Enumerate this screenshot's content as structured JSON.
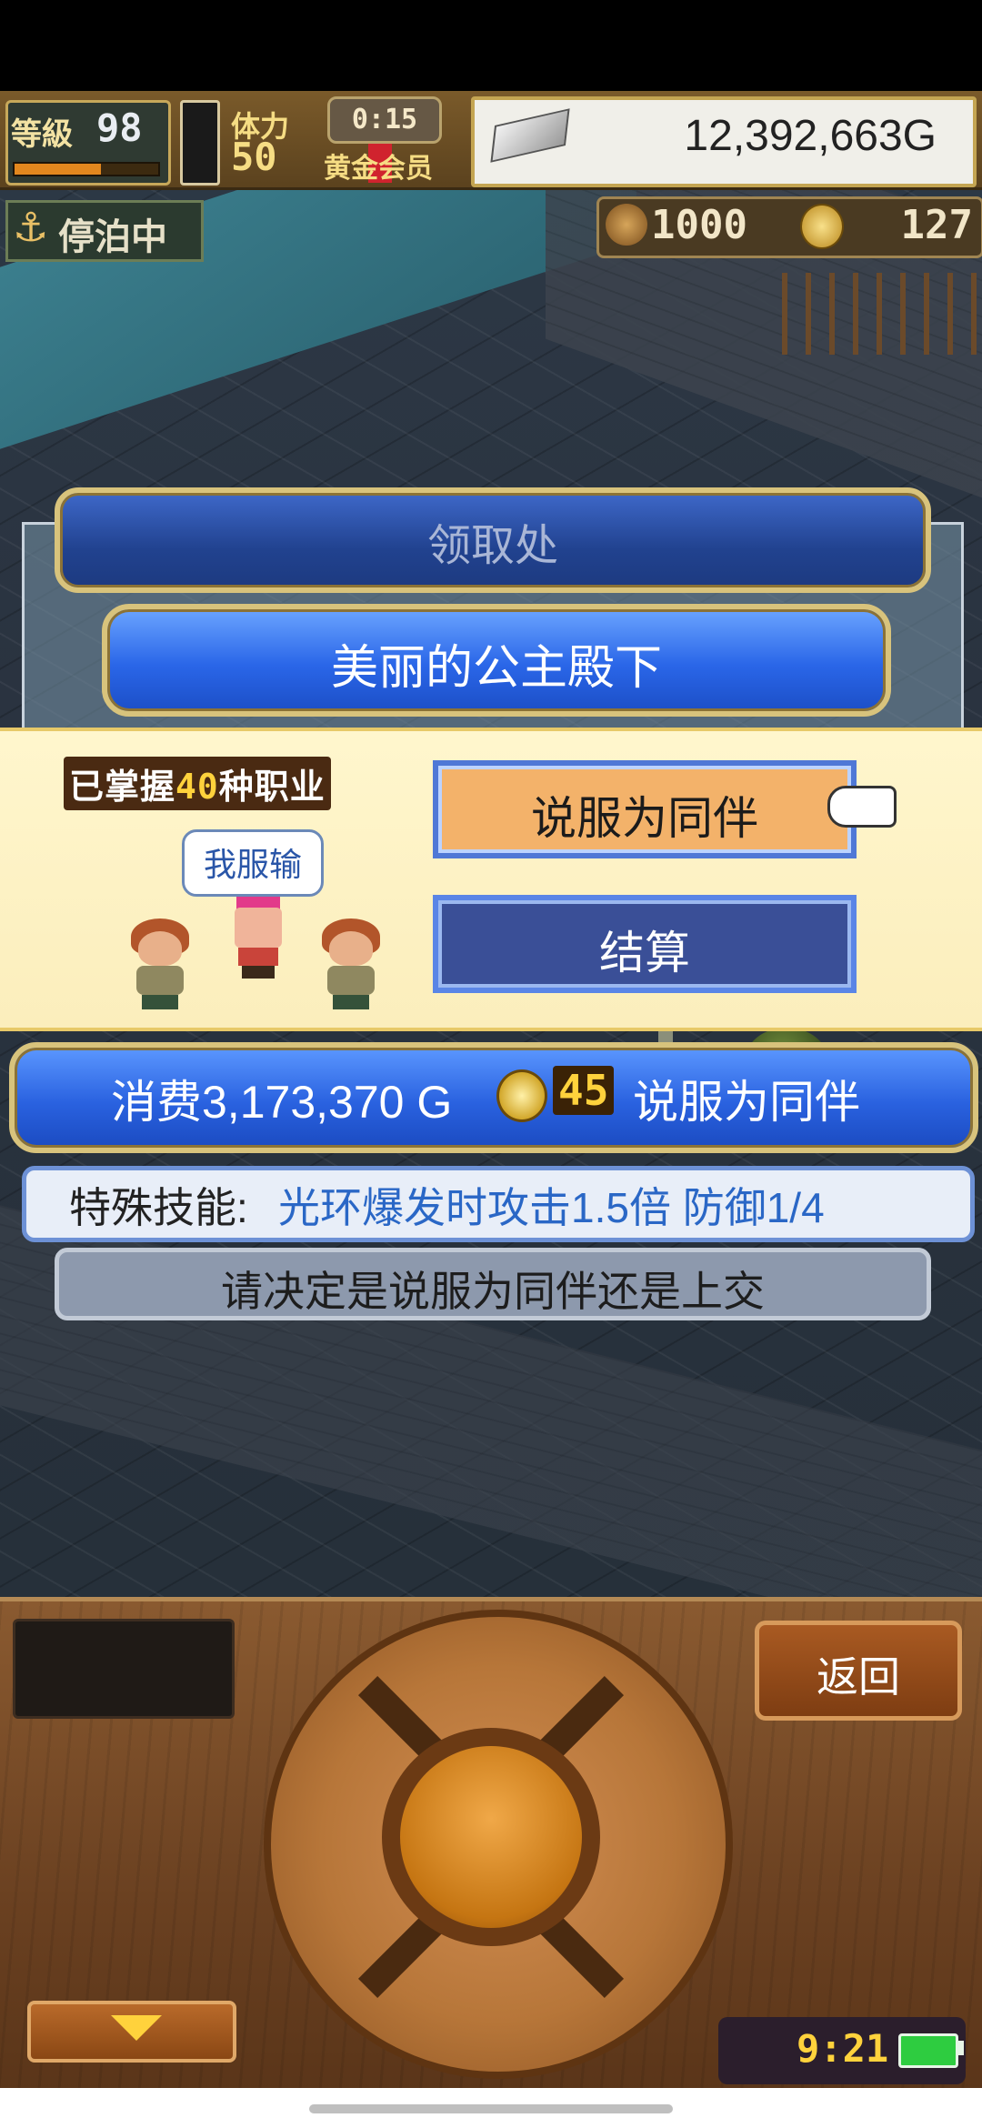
{
  "hud": {
    "level_label": "等級",
    "level": "98",
    "level_progress": 0.62,
    "stamina_label": "体力",
    "stamina": "50",
    "stamina_fill": 0.55,
    "timer": "0:15",
    "membership": "黄金会员",
    "money": "12,392,663G",
    "dock_status": "停泊中",
    "wood": "1000",
    "medals": "127"
  },
  "reception": {
    "title": "领取处"
  },
  "hero": {
    "title": "美丽的公主殿下"
  },
  "panel": {
    "jobs_prefix": "已掌握",
    "jobs_count": "40",
    "jobs_suffix": "种职业",
    "speech": "我服输",
    "persuade_label": "说服为同伴",
    "settle_label": "结算"
  },
  "cost": {
    "prefix": "消费3,173,370 G",
    "coin_count": "45",
    "suffix": "说服为同伴"
  },
  "skill": {
    "label": "特殊技能:",
    "value": "光环爆发时攻击1.5倍 防御1/4"
  },
  "prompt": "请决定是说服为同伴还是上交",
  "controller": {
    "back_label": "返回",
    "clock": "9:21",
    "battery_level": 1.0
  },
  "colors": {
    "accent_blue": "#2a66e8",
    "button_orange": "#f3b26a",
    "skill_text": "#2a67c6",
    "gold": "#ffd23c"
  }
}
